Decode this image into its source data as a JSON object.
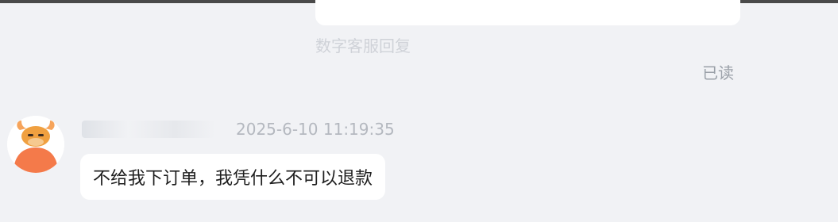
{
  "chat": {
    "top_reply_label": "数字客服回复",
    "read_status": "已读",
    "message": {
      "timestamp": "2025-6-10 11:19:35",
      "text": "不给我下订单，我凭什么不可以退款"
    }
  },
  "icons": {
    "avatar": "bull-avatar-icon"
  },
  "colors": {
    "background": "#f1f2f5",
    "bubble": "#ffffff",
    "avatar_orange": "#f47a4a"
  }
}
